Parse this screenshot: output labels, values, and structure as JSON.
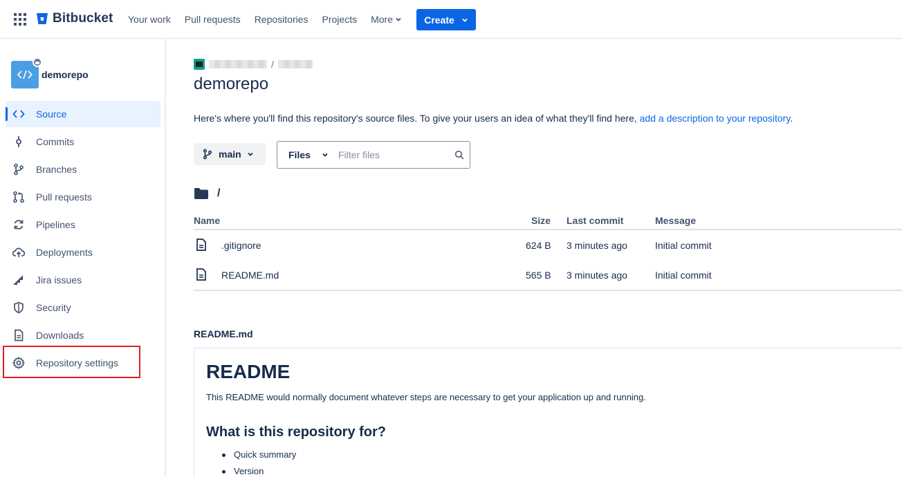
{
  "topnav": {
    "brand": "Bitbucket",
    "links": [
      {
        "label": "Your work"
      },
      {
        "label": "Pull requests"
      },
      {
        "label": "Repositories"
      },
      {
        "label": "Projects"
      },
      {
        "label": "More"
      }
    ],
    "create_label": "Create"
  },
  "sidebar": {
    "repo_name": "demorepo",
    "items": [
      {
        "label": "Source",
        "icon": "code-icon"
      },
      {
        "label": "Commits",
        "icon": "commit-icon"
      },
      {
        "label": "Branches",
        "icon": "branch-icon"
      },
      {
        "label": "Pull requests",
        "icon": "pull-request-icon"
      },
      {
        "label": "Pipelines",
        "icon": "refresh-icon"
      },
      {
        "label": "Deployments",
        "icon": "cloud-upload-icon"
      },
      {
        "label": "Jira issues",
        "icon": "jira-icon"
      },
      {
        "label": "Security",
        "icon": "shield-icon"
      },
      {
        "label": "Downloads",
        "icon": "file-icon"
      },
      {
        "label": "Repository settings",
        "icon": "gear-icon"
      }
    ]
  },
  "main": {
    "breadcrumb_sep": "/",
    "title": "demorepo",
    "description_text": "Here's where you'll find this repository's source files. To give your users an idea of what they'll find here, ",
    "description_link": "add a description to your repository",
    "description_end": ".",
    "branch": "main",
    "files_select": "Files",
    "filter_placeholder": "Filter files",
    "path": "/",
    "table": {
      "headers": {
        "name": "Name",
        "size": "Size",
        "last_commit": "Last commit",
        "message": "Message"
      },
      "rows": [
        {
          "name": ".gitignore",
          "size": "624 B",
          "last_commit": "3 minutes ago",
          "message": "Initial commit"
        },
        {
          "name": "README.md",
          "size": "565 B",
          "last_commit": "3 minutes ago",
          "message": "Initial commit"
        }
      ]
    },
    "readme": {
      "label": "README.md",
      "h1": "README",
      "p": "This README would normally document whatever steps are necessary to get your application up and running.",
      "h2": "What is this repository for?",
      "list": [
        "Quick summary",
        "Version"
      ]
    }
  },
  "colors": {
    "accent": "#0c66e4",
    "highlight": "#e01e1e",
    "avatar": "#4c9ee3"
  }
}
